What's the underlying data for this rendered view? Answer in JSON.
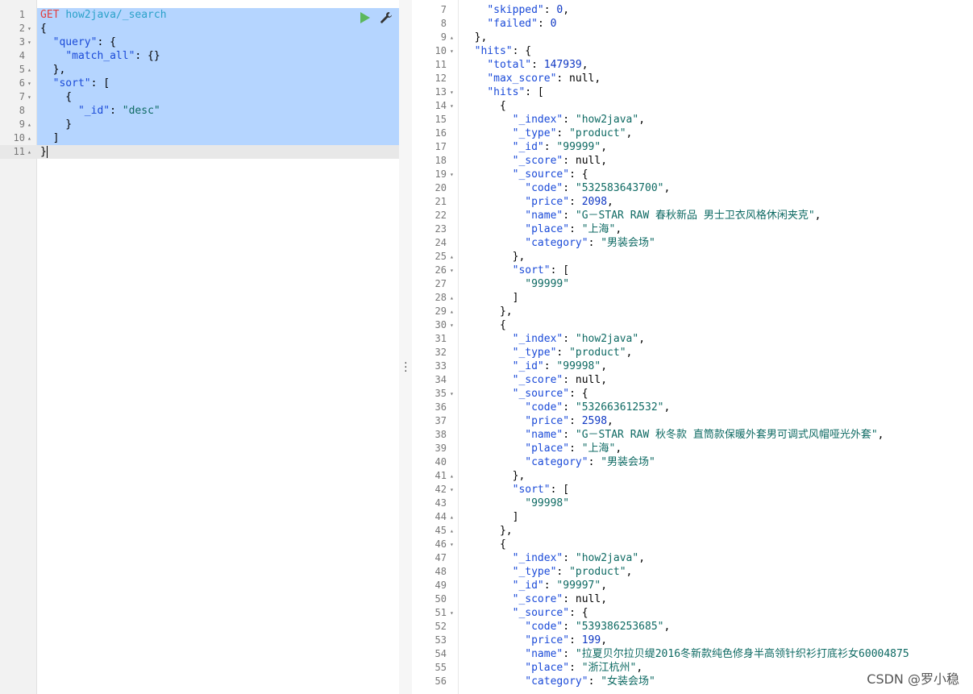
{
  "request": {
    "method": "GET",
    "url": "how2java/_search",
    "lines": [
      {
        "n": "1",
        "fold": "",
        "tokens": [
          [
            "method",
            "GET"
          ],
          [
            "p",
            " "
          ],
          [
            "url",
            "how2java/_search"
          ]
        ]
      },
      {
        "n": "2",
        "fold": "▾",
        "tokens": [
          [
            "p",
            "{"
          ]
        ]
      },
      {
        "n": "3",
        "fold": "▾",
        "tokens": [
          [
            "p",
            "  "
          ],
          [
            "k",
            "\"query\""
          ],
          [
            "p",
            ": {"
          ]
        ]
      },
      {
        "n": "4",
        "fold": "",
        "tokens": [
          [
            "p",
            "    "
          ],
          [
            "k",
            "\"match_all\""
          ],
          [
            "p",
            ": {}"
          ]
        ]
      },
      {
        "n": "5",
        "fold": "▴",
        "tokens": [
          [
            "p",
            "  },"
          ]
        ]
      },
      {
        "n": "6",
        "fold": "▾",
        "tokens": [
          [
            "p",
            "  "
          ],
          [
            "k",
            "\"sort\""
          ],
          [
            "p",
            ": ["
          ]
        ]
      },
      {
        "n": "7",
        "fold": "▾",
        "tokens": [
          [
            "p",
            "    {"
          ]
        ]
      },
      {
        "n": "8",
        "fold": "",
        "tokens": [
          [
            "p",
            "      "
          ],
          [
            "k",
            "\"_id\""
          ],
          [
            "p",
            ": "
          ],
          [
            "str",
            "\"desc\""
          ]
        ]
      },
      {
        "n": "9",
        "fold": "▴",
        "tokens": [
          [
            "p",
            "    }"
          ]
        ]
      },
      {
        "n": "10",
        "fold": "▴",
        "tokens": [
          [
            "p",
            "  ]"
          ]
        ]
      },
      {
        "n": "11",
        "fold": "▴",
        "tokens": [
          [
            "p",
            "}"
          ]
        ]
      }
    ]
  },
  "response": {
    "lines": [
      {
        "n": "7",
        "fold": "",
        "tokens": [
          [
            "p",
            "    "
          ],
          [
            "k",
            "\"skipped\""
          ],
          [
            "p",
            ": "
          ],
          [
            "num",
            "0"
          ],
          [
            "p",
            ","
          ]
        ]
      },
      {
        "n": "8",
        "fold": "",
        "tokens": [
          [
            "p",
            "    "
          ],
          [
            "k",
            "\"failed\""
          ],
          [
            "p",
            ": "
          ],
          [
            "num",
            "0"
          ]
        ]
      },
      {
        "n": "9",
        "fold": "▴",
        "tokens": [
          [
            "p",
            "  },"
          ]
        ]
      },
      {
        "n": "10",
        "fold": "▾",
        "tokens": [
          [
            "p",
            "  "
          ],
          [
            "k",
            "\"hits\""
          ],
          [
            "p",
            ": {"
          ]
        ]
      },
      {
        "n": "11",
        "fold": "",
        "tokens": [
          [
            "p",
            "    "
          ],
          [
            "k",
            "\"total\""
          ],
          [
            "p",
            ": "
          ],
          [
            "num",
            "147939"
          ],
          [
            "p",
            ","
          ]
        ]
      },
      {
        "n": "12",
        "fold": "",
        "tokens": [
          [
            "p",
            "    "
          ],
          [
            "k",
            "\"max_score\""
          ],
          [
            "p",
            ": null,"
          ]
        ]
      },
      {
        "n": "13",
        "fold": "▾",
        "tokens": [
          [
            "p",
            "    "
          ],
          [
            "k",
            "\"hits\""
          ],
          [
            "p",
            ": ["
          ]
        ]
      },
      {
        "n": "14",
        "fold": "▾",
        "tokens": [
          [
            "p",
            "      {"
          ]
        ]
      },
      {
        "n": "15",
        "fold": "",
        "tokens": [
          [
            "p",
            "        "
          ],
          [
            "k",
            "\"_index\""
          ],
          [
            "p",
            ": "
          ],
          [
            "str",
            "\"how2java\""
          ],
          [
            "p",
            ","
          ]
        ]
      },
      {
        "n": "16",
        "fold": "",
        "tokens": [
          [
            "p",
            "        "
          ],
          [
            "k",
            "\"_type\""
          ],
          [
            "p",
            ": "
          ],
          [
            "str",
            "\"product\""
          ],
          [
            "p",
            ","
          ]
        ]
      },
      {
        "n": "17",
        "fold": "",
        "tokens": [
          [
            "p",
            "        "
          ],
          [
            "k",
            "\"_id\""
          ],
          [
            "p",
            ": "
          ],
          [
            "str",
            "\"99999\""
          ],
          [
            "p",
            ","
          ]
        ]
      },
      {
        "n": "18",
        "fold": "",
        "tokens": [
          [
            "p",
            "        "
          ],
          [
            "k",
            "\"_score\""
          ],
          [
            "p",
            ": null,"
          ]
        ]
      },
      {
        "n": "19",
        "fold": "▾",
        "tokens": [
          [
            "p",
            "        "
          ],
          [
            "k",
            "\"_source\""
          ],
          [
            "p",
            ": {"
          ]
        ]
      },
      {
        "n": "20",
        "fold": "",
        "tokens": [
          [
            "p",
            "          "
          ],
          [
            "k",
            "\"code\""
          ],
          [
            "p",
            ": "
          ],
          [
            "str",
            "\"532583643700\""
          ],
          [
            "p",
            ","
          ]
        ]
      },
      {
        "n": "21",
        "fold": "",
        "tokens": [
          [
            "p",
            "          "
          ],
          [
            "k",
            "\"price\""
          ],
          [
            "p",
            ": "
          ],
          [
            "num",
            "2098"
          ],
          [
            "p",
            ","
          ]
        ]
      },
      {
        "n": "22",
        "fold": "",
        "tokens": [
          [
            "p",
            "          "
          ],
          [
            "k",
            "\"name\""
          ],
          [
            "p",
            ": "
          ],
          [
            "str",
            "\"G－STAR RAW 春秋新品 男士卫衣风格休闲夹克\""
          ],
          [
            "p",
            ","
          ]
        ]
      },
      {
        "n": "23",
        "fold": "",
        "tokens": [
          [
            "p",
            "          "
          ],
          [
            "k",
            "\"place\""
          ],
          [
            "p",
            ": "
          ],
          [
            "str",
            "\"上海\""
          ],
          [
            "p",
            ","
          ]
        ]
      },
      {
        "n": "24",
        "fold": "",
        "tokens": [
          [
            "p",
            "          "
          ],
          [
            "k",
            "\"category\""
          ],
          [
            "p",
            ": "
          ],
          [
            "str",
            "\"男装会场\""
          ]
        ]
      },
      {
        "n": "25",
        "fold": "▴",
        "tokens": [
          [
            "p",
            "        },"
          ]
        ]
      },
      {
        "n": "26",
        "fold": "▾",
        "tokens": [
          [
            "p",
            "        "
          ],
          [
            "k",
            "\"sort\""
          ],
          [
            "p",
            ": ["
          ]
        ]
      },
      {
        "n": "27",
        "fold": "",
        "tokens": [
          [
            "p",
            "          "
          ],
          [
            "str",
            "\"99999\""
          ]
        ]
      },
      {
        "n": "28",
        "fold": "▴",
        "tokens": [
          [
            "p",
            "        ]"
          ]
        ]
      },
      {
        "n": "29",
        "fold": "▴",
        "tokens": [
          [
            "p",
            "      },"
          ]
        ]
      },
      {
        "n": "30",
        "fold": "▾",
        "tokens": [
          [
            "p",
            "      {"
          ]
        ]
      },
      {
        "n": "31",
        "fold": "",
        "tokens": [
          [
            "p",
            "        "
          ],
          [
            "k",
            "\"_index\""
          ],
          [
            "p",
            ": "
          ],
          [
            "str",
            "\"how2java\""
          ],
          [
            "p",
            ","
          ]
        ]
      },
      {
        "n": "32",
        "fold": "",
        "tokens": [
          [
            "p",
            "        "
          ],
          [
            "k",
            "\"_type\""
          ],
          [
            "p",
            ": "
          ],
          [
            "str",
            "\"product\""
          ],
          [
            "p",
            ","
          ]
        ]
      },
      {
        "n": "33",
        "fold": "",
        "tokens": [
          [
            "p",
            "        "
          ],
          [
            "k",
            "\"_id\""
          ],
          [
            "p",
            ": "
          ],
          [
            "str",
            "\"99998\""
          ],
          [
            "p",
            ","
          ]
        ]
      },
      {
        "n": "34",
        "fold": "",
        "tokens": [
          [
            "p",
            "        "
          ],
          [
            "k",
            "\"_score\""
          ],
          [
            "p",
            ": null,"
          ]
        ]
      },
      {
        "n": "35",
        "fold": "▾",
        "tokens": [
          [
            "p",
            "        "
          ],
          [
            "k",
            "\"_source\""
          ],
          [
            "p",
            ": {"
          ]
        ]
      },
      {
        "n": "36",
        "fold": "",
        "tokens": [
          [
            "p",
            "          "
          ],
          [
            "k",
            "\"code\""
          ],
          [
            "p",
            ": "
          ],
          [
            "str",
            "\"532663612532\""
          ],
          [
            "p",
            ","
          ]
        ]
      },
      {
        "n": "37",
        "fold": "",
        "tokens": [
          [
            "p",
            "          "
          ],
          [
            "k",
            "\"price\""
          ],
          [
            "p",
            ": "
          ],
          [
            "num",
            "2598"
          ],
          [
            "p",
            ","
          ]
        ]
      },
      {
        "n": "38",
        "fold": "",
        "tokens": [
          [
            "p",
            "          "
          ],
          [
            "k",
            "\"name\""
          ],
          [
            "p",
            ": "
          ],
          [
            "str",
            "\"G－STAR RAW 秋冬款 直筒款保暖外套男可调式风帽哑光外套\""
          ],
          [
            "p",
            ","
          ]
        ]
      },
      {
        "n": "39",
        "fold": "",
        "tokens": [
          [
            "p",
            "          "
          ],
          [
            "k",
            "\"place\""
          ],
          [
            "p",
            ": "
          ],
          [
            "str",
            "\"上海\""
          ],
          [
            "p",
            ","
          ]
        ]
      },
      {
        "n": "40",
        "fold": "",
        "tokens": [
          [
            "p",
            "          "
          ],
          [
            "k",
            "\"category\""
          ],
          [
            "p",
            ": "
          ],
          [
            "str",
            "\"男装会场\""
          ]
        ]
      },
      {
        "n": "41",
        "fold": "▴",
        "tokens": [
          [
            "p",
            "        },"
          ]
        ]
      },
      {
        "n": "42",
        "fold": "▾",
        "tokens": [
          [
            "p",
            "        "
          ],
          [
            "k",
            "\"sort\""
          ],
          [
            "p",
            ": ["
          ]
        ]
      },
      {
        "n": "43",
        "fold": "",
        "tokens": [
          [
            "p",
            "          "
          ],
          [
            "str",
            "\"99998\""
          ]
        ]
      },
      {
        "n": "44",
        "fold": "▴",
        "tokens": [
          [
            "p",
            "        ]"
          ]
        ]
      },
      {
        "n": "45",
        "fold": "▴",
        "tokens": [
          [
            "p",
            "      },"
          ]
        ]
      },
      {
        "n": "46",
        "fold": "▾",
        "tokens": [
          [
            "p",
            "      {"
          ]
        ]
      },
      {
        "n": "47",
        "fold": "",
        "tokens": [
          [
            "p",
            "        "
          ],
          [
            "k",
            "\"_index\""
          ],
          [
            "p",
            ": "
          ],
          [
            "str",
            "\"how2java\""
          ],
          [
            "p",
            ","
          ]
        ]
      },
      {
        "n": "48",
        "fold": "",
        "tokens": [
          [
            "p",
            "        "
          ],
          [
            "k",
            "\"_type\""
          ],
          [
            "p",
            ": "
          ],
          [
            "str",
            "\"product\""
          ],
          [
            "p",
            ","
          ]
        ]
      },
      {
        "n": "49",
        "fold": "",
        "tokens": [
          [
            "p",
            "        "
          ],
          [
            "k",
            "\"_id\""
          ],
          [
            "p",
            ": "
          ],
          [
            "str",
            "\"99997\""
          ],
          [
            "p",
            ","
          ]
        ]
      },
      {
        "n": "50",
        "fold": "",
        "tokens": [
          [
            "p",
            "        "
          ],
          [
            "k",
            "\"_score\""
          ],
          [
            "p",
            ": null,"
          ]
        ]
      },
      {
        "n": "51",
        "fold": "▾",
        "tokens": [
          [
            "p",
            "        "
          ],
          [
            "k",
            "\"_source\""
          ],
          [
            "p",
            ": {"
          ]
        ]
      },
      {
        "n": "52",
        "fold": "",
        "tokens": [
          [
            "p",
            "          "
          ],
          [
            "k",
            "\"code\""
          ],
          [
            "p",
            ": "
          ],
          [
            "str",
            "\"539386253685\""
          ],
          [
            "p",
            ","
          ]
        ]
      },
      {
        "n": "53",
        "fold": "",
        "tokens": [
          [
            "p",
            "          "
          ],
          [
            "k",
            "\"price\""
          ],
          [
            "p",
            ": "
          ],
          [
            "num",
            "199"
          ],
          [
            "p",
            ","
          ]
        ]
      },
      {
        "n": "54",
        "fold": "",
        "tokens": [
          [
            "p",
            "          "
          ],
          [
            "k",
            "\"name\""
          ],
          [
            "p",
            ": "
          ],
          [
            "str",
            "\"拉夏贝尔拉贝缇2016冬新款纯色修身半高领针织衫打底衫女60004875"
          ]
        ]
      },
      {
        "n": "55",
        "fold": "",
        "tokens": [
          [
            "p",
            "          "
          ],
          [
            "k",
            "\"place\""
          ],
          [
            "p",
            ": "
          ],
          [
            "str",
            "\"浙江杭州\""
          ],
          [
            "p",
            ","
          ]
        ]
      },
      {
        "n": "56",
        "fold": "",
        "tokens": [
          [
            "p",
            "          "
          ],
          [
            "k",
            "\"category\""
          ],
          [
            "p",
            ": "
          ],
          [
            "str",
            "\"女装会场\""
          ]
        ]
      }
    ]
  },
  "toolbar": {
    "run_icon": "play-icon",
    "settings_icon": "wrench-icon"
  },
  "watermark": "CSDN @罗小稳",
  "colors": {
    "selection": "#b5d5ff",
    "key": "#1a4ad8",
    "string": "#0e6a63",
    "number": "#0e37c3",
    "method": "#e23e3e",
    "url": "#2aa1c9",
    "run": "#5cb85c"
  }
}
